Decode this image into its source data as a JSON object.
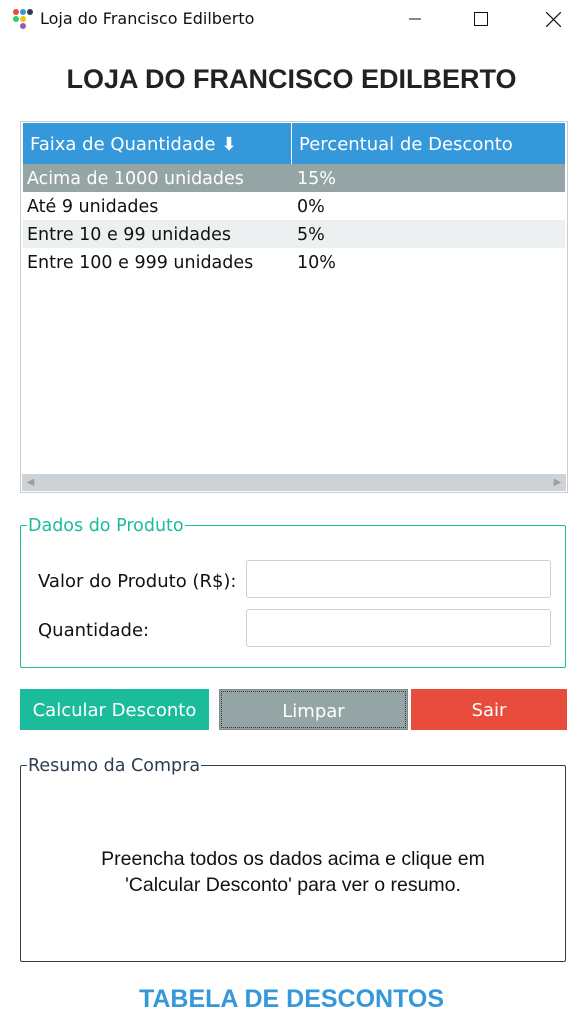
{
  "window": {
    "title": "Loja do Francisco Edilberto",
    "minimize_icon": "minimize-icon",
    "maximize_icon": "maximize-icon",
    "close_icon": "close-icon"
  },
  "header": {
    "title": "LOJA DO FRANCISCO EDILBERTO"
  },
  "table": {
    "columns": [
      "Faixa de Quantidade",
      "Percentual de Desconto"
    ],
    "sort_icon": "⬇",
    "rows": [
      [
        "Acima de 1000 unidades",
        "15%"
      ],
      [
        "Até 9 unidades",
        "0%"
      ],
      [
        "Entre 10 e 99 unidades",
        "5%"
      ],
      [
        "Entre 100 e 999 unidades",
        "10%"
      ]
    ],
    "selected_row": 0
  },
  "produto": {
    "legend": "Dados do Produto",
    "valor_label": "Valor do Produto (R$):",
    "valor_value": "",
    "quantidade_label": "Quantidade:",
    "quantidade_value": ""
  },
  "buttons": {
    "calcular": "Calcular Desconto",
    "limpar": "Limpar",
    "sair": "Sair"
  },
  "resumo": {
    "legend": "Resumo da Compra",
    "line1": "Preencha todos os dados acima e clique em",
    "line2": "'Calcular Desconto' para ver o resumo."
  },
  "footer": {
    "title": "TABELA DE DESCONTOS"
  },
  "colors": {
    "accent_blue": "#3498db",
    "teal": "#1abc9c",
    "gray": "#95a5a6",
    "red": "#e74c3c",
    "dark": "#2c3e50"
  }
}
